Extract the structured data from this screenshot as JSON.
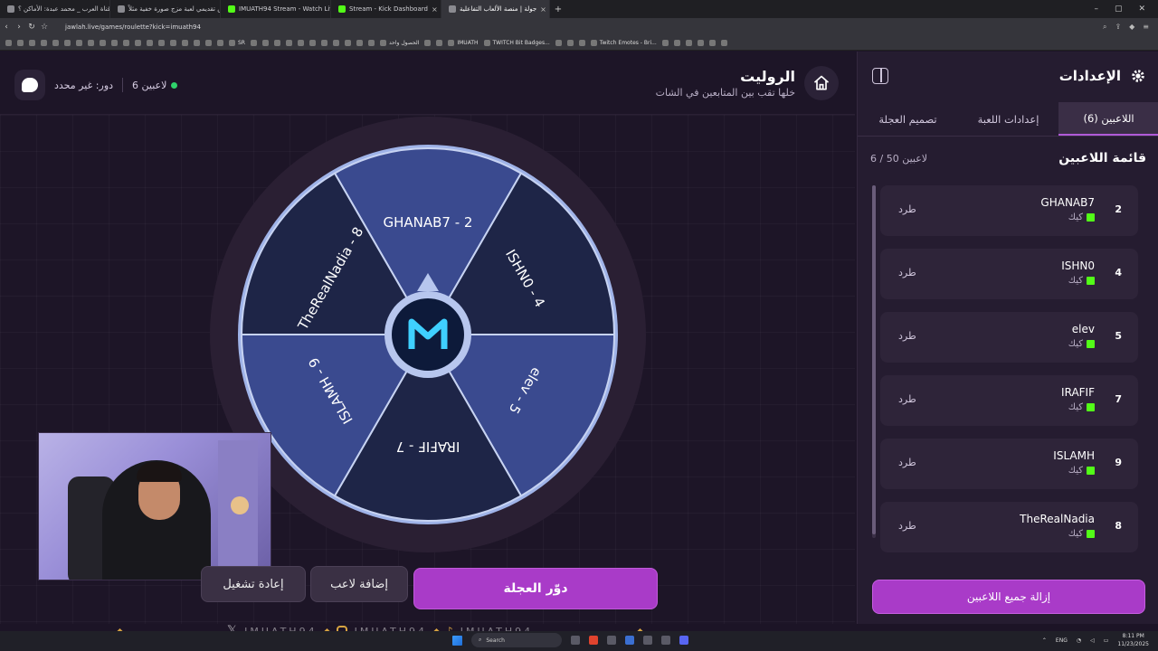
{
  "browser": {
    "tabs": [
      {
        "title": "قناة العرب _ محمد عبدة: الأماكن ؟",
        "kick": false
      },
      {
        "title": "عرض تقديمي لعبة مزج صورة خفية مثلاً",
        "kick": false
      },
      {
        "title": "IMUATH94 Stream - Watch Live on Kick",
        "kick": true
      },
      {
        "title": "Stream - Kick Dashboard",
        "kick": true
      },
      {
        "title": "جولة | منصة الألعاب التفاعلية",
        "kick": false,
        "active": true
      }
    ],
    "url": "jawlah.live/games/roulette?kick=imuath94",
    "bookmarks": [
      "SR",
      "الحصول واحد",
      "IMUATH",
      "TWITCH Bit Badges...",
      "Twitch Emotes - Bri..."
    ]
  },
  "header": {
    "title": "الروليت",
    "subtitle": "خلها تقب بين المتابعين في الشات",
    "turn": "دور: غير محدد",
    "players": "6 لاعبين"
  },
  "wheel": {
    "segments": [
      {
        "label": "GHANAB7 - 2",
        "color": "#3a4a8f"
      },
      {
        "label": "ISHN0 - 4",
        "color": "#1e2547"
      },
      {
        "label": "elev - 5",
        "color": "#3a4a8f"
      },
      {
        "label": "IRAFIF - 7",
        "color": "#1e2547"
      },
      {
        "label": "ISLAMH - 9",
        "color": "#3a4a8f"
      },
      {
        "label": "TheRealNadia - 8",
        "color": "#1e2547"
      }
    ]
  },
  "buttons": {
    "spin": "دوّر العجلة",
    "add": "إضافة لاعب",
    "reset": "إعادة تشغيل"
  },
  "overlay": {
    "handle": "IMUATH94"
  },
  "sidebar": {
    "title": "الإعدادات",
    "tabs": [
      "اللاعبين (6)",
      "إعدادات اللعبة",
      "تصميم العجلة"
    ],
    "list_title": "قائمة اللاعبين",
    "list_count": "6 / 50 لاعبين",
    "kick_label": "طرد",
    "players": [
      {
        "num": "2",
        "name": "GHANAB7",
        "platform": "كيك"
      },
      {
        "num": "4",
        "name": "ISHN0",
        "platform": "كيك"
      },
      {
        "num": "5",
        "name": "elev",
        "platform": "كيك"
      },
      {
        "num": "7",
        "name": "IRAFIF",
        "platform": "كيك"
      },
      {
        "num": "9",
        "name": "ISLAMH",
        "platform": "كيك"
      },
      {
        "num": "8",
        "name": "TheRealNadia",
        "platform": "كيك"
      }
    ],
    "remove_all": "إزالة جميع اللاعبين"
  },
  "taskbar": {
    "search": "Search",
    "lang": "ENG",
    "time": "8:11 PM",
    "date": "11/23/2025"
  },
  "colors": {
    "accent": "#a93bc8",
    "kick_green": "#53fc18",
    "online_green": "#2fd26b"
  }
}
